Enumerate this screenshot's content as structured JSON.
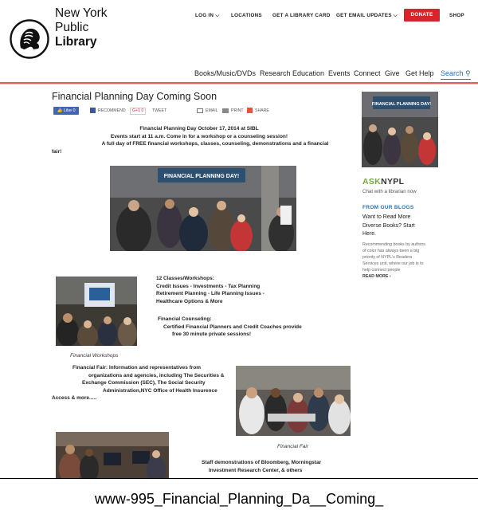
{
  "logo": {
    "line1": "New York",
    "line2": "Public",
    "line3": "Library"
  },
  "top_nav": {
    "login": "LOG IN ⌵",
    "locations": "LOCATIONS",
    "library_card": "GET A LIBRARY CARD",
    "email_updates": "GET EMAIL UPDATES ⌵",
    "donate": "DONATE",
    "shop": "SHOP"
  },
  "main_nav": {
    "books": "Books/Music/DVDs",
    "research": "Research",
    "education": "Education",
    "events": "Events",
    "connect": "Connect",
    "give": "Give",
    "get_help": "Get Help",
    "search": "Search ⚲"
  },
  "article": {
    "title": "Financial Planning Day Coming Soon",
    "share": {
      "like": "👍 Like 0",
      "recommend": "RECOMMEND",
      "gplus": "G+1 0",
      "tweet": "TWEET",
      "email": "EMAIL",
      "print": "PRINT",
      "share": "SHARE"
    },
    "intro": {
      "line1": "Financial Planning Day October 17, 2014 at SIBL",
      "line2": "Events start at 11 a.m.  Come  in for a workshop or a counseling session!",
      "line3": "A full day of FREE financial workshops, classes, counseling, demonstrations and a financial",
      "line4": "fair!"
    },
    "hero_banner": "FINANCIAL PLANNING DAY!",
    "classes": {
      "h": "12 Classes/Workshops:",
      "l1": "Credit Issues - Investments - Tax Planning",
      "l2": "Retirement Planning - Life Planning Issues -",
      "l3": "Healthcare Options  & More"
    },
    "counseling": {
      "h": "Financial Counseling:",
      "l1": "Certified Financial Planners and Credit Coaches provide",
      "l2": "free 30 minute private sessions!"
    },
    "caption_workshops": "Financial Workshops",
    "fair": {
      "l1": "Financial Fair:   Information and representatives from",
      "l2": "organizations and agencies, including The Securities &",
      "l3": "Exchange Commission (SEC), The Social Security",
      "l4": "Administration,NYC  Office of Health Insurence",
      "l5": "Access &             more....."
    },
    "caption_fair": "Financial Fair",
    "staff": {
      "l1": "Staff demonstrations of Bloomberg, Morningstar",
      "l2": "Investment Research Center, & others"
    }
  },
  "sidebar": {
    "promo_banner": "FINANCIAL PLANNING DAY!",
    "ask_a": "ASK",
    "ask_b": "NYPL",
    "ask_sub": "Chat with a librarian now",
    "blogs_heading": "FROM OUR BLOGS",
    "blog_title": "Want to Read More Diverse Books? Start Here.",
    "blog_desc": "Recommending books by authors of color has always been a big priority of NYPL's Readers Services unit, where our job is to help connect people",
    "read_more": "READ MORE ›"
  },
  "footer": {
    "filename": "www-995_Financial_Planning_Da__Coming_"
  },
  "colors": {
    "accent_red": "#d8252c",
    "link_blue": "#2a71b8",
    "ask_green": "#75a93a"
  }
}
